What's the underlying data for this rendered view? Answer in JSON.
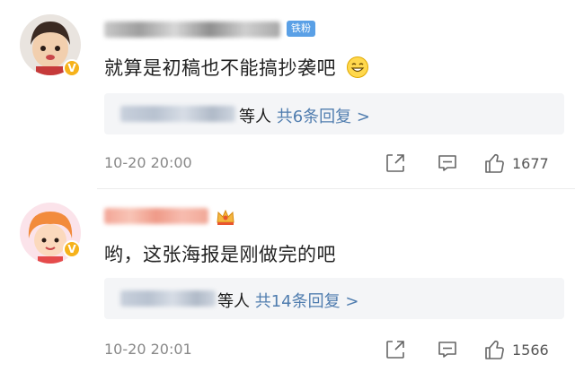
{
  "comments": [
    {
      "fan_badge": "铁粉",
      "text": "就算是初稿也不能搞抄袭吧",
      "reply_suffix": "等人",
      "reply_link": "共6条回复 >",
      "time": "10-20 20:00",
      "likes": "1677",
      "verified_icon": "v-badge-icon",
      "emoji_icon": "grin-emoji-icon"
    },
    {
      "text": "哟，这张海报是刚做完的吧",
      "reply_suffix": "等人",
      "reply_link": "共14条回复 >",
      "time": "10-20 20:01",
      "likes": "1566",
      "verified_icon": "v-badge-icon",
      "crown_icon": "crown-badge-icon"
    }
  ],
  "icons": {
    "share": "share-icon",
    "comment": "comment-icon",
    "like": "thumbs-up-icon"
  },
  "colors": {
    "fan_badge": "#5aa0e6",
    "reply_link": "#507daf",
    "verified": "#f6b21b",
    "meta": "#888888"
  }
}
